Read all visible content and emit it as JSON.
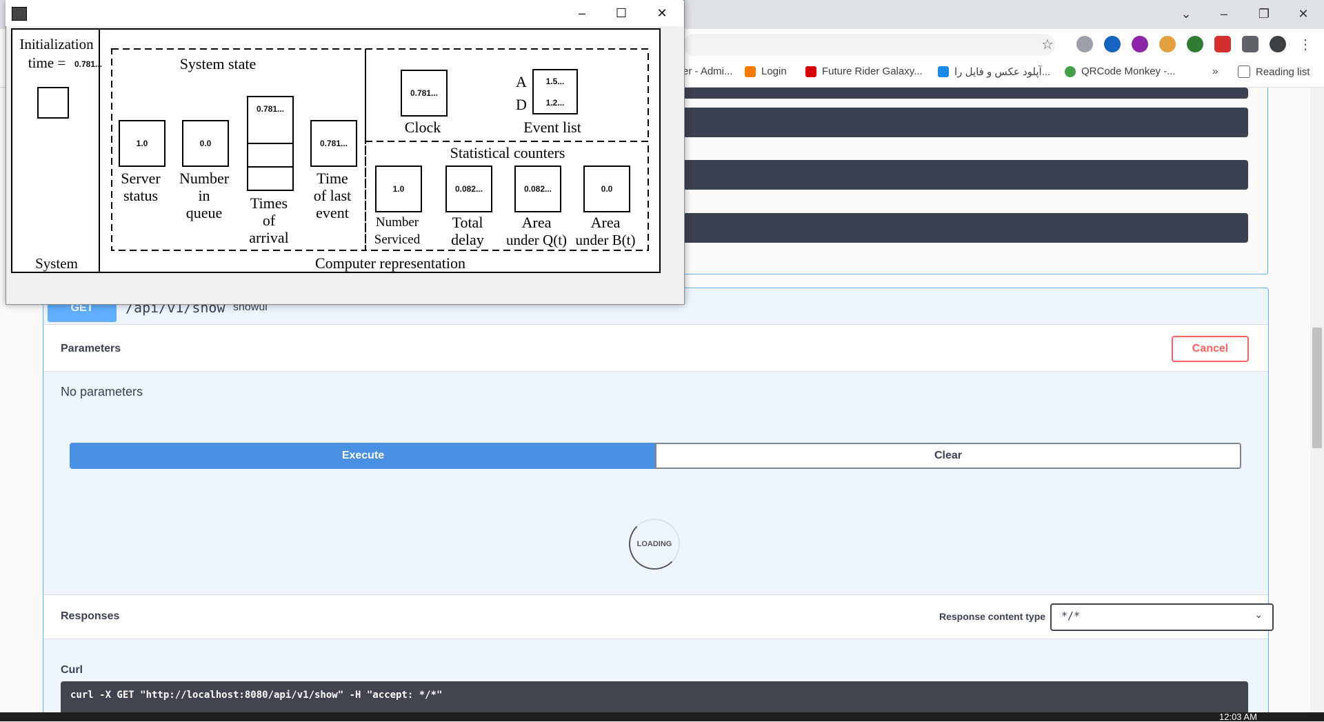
{
  "browser": {
    "bookmarks": [
      {
        "label": "er - Admi...",
        "color": "#ffffff"
      },
      {
        "label": "Login",
        "color": "#f57c00"
      },
      {
        "label": "Future Rider Galaxy...",
        "color": "#d50000"
      },
      {
        "label": "آپلود عکس و فایل را...",
        "color": "#1e88e5"
      },
      {
        "label": "QRCode Monkey -...",
        "color": "#43a047"
      }
    ],
    "bookmarks_more": "»",
    "reading_list": "Reading list"
  },
  "swagger": {
    "method": "GET",
    "path": "/api/v1/show",
    "description": "showui",
    "parameters_title": "Parameters",
    "cancel_label": "Cancel",
    "no_parameters": "No parameters",
    "execute_label": "Execute",
    "clear_label": "Clear",
    "loading_label": "LOADING",
    "responses_title": "Responses",
    "response_content_type_label": "Response content type",
    "response_content_type_value": "*/*",
    "curl_title": "Curl",
    "curl_command": "curl -X GET \"http://localhost:8080/api/v1/show\" -H \"accept: */*\""
  },
  "taskbar": {
    "clock": "12:03 AM"
  },
  "app_window": {
    "initialization_label_1": "Initialization",
    "initialization_label_2": "time =",
    "initialization_value": "0.781...",
    "system_label": "System",
    "system_state_label": "System state",
    "server_status_value": "1.0",
    "server_status_label_1": "Server",
    "server_status_label_2": "status",
    "number_in_queue_value": "0.0",
    "number_in_queue_label_1": "Number",
    "number_in_queue_label_2": "in",
    "number_in_queue_label_3": "queue",
    "times_of_arrival_value": "0.781...",
    "times_of_arrival_label_1": "Times",
    "times_of_arrival_label_2": "of",
    "times_of_arrival_label_3": "arrival",
    "time_of_last_event_value": "0.781...",
    "time_of_last_event_label_1": "Time",
    "time_of_last_event_label_2": "of last",
    "time_of_last_event_label_3": "event",
    "clock_value": "0.781...",
    "clock_label": "Clock",
    "event_a_label": "A",
    "event_a_value": "1.5...",
    "event_d_label": "D",
    "event_d_value": "1.2...",
    "event_list_label": "Event list",
    "statistical_counters_label": "Statistical counters",
    "number_serviced_value": "1.0",
    "number_serviced_label_1": "Number",
    "number_serviced_label_2": "Serviced",
    "total_delay_value": "0.082...",
    "total_delay_label_1": "Total",
    "total_delay_label_2": "delay",
    "area_q_value": "0.082...",
    "area_q_label_1": "Area",
    "area_q_label_2": "under Q(t)",
    "area_b_value": "0.0",
    "area_b_label_1": "Area",
    "area_b_label_2": "under B(t)",
    "computer_representation_label": "Computer representation"
  }
}
